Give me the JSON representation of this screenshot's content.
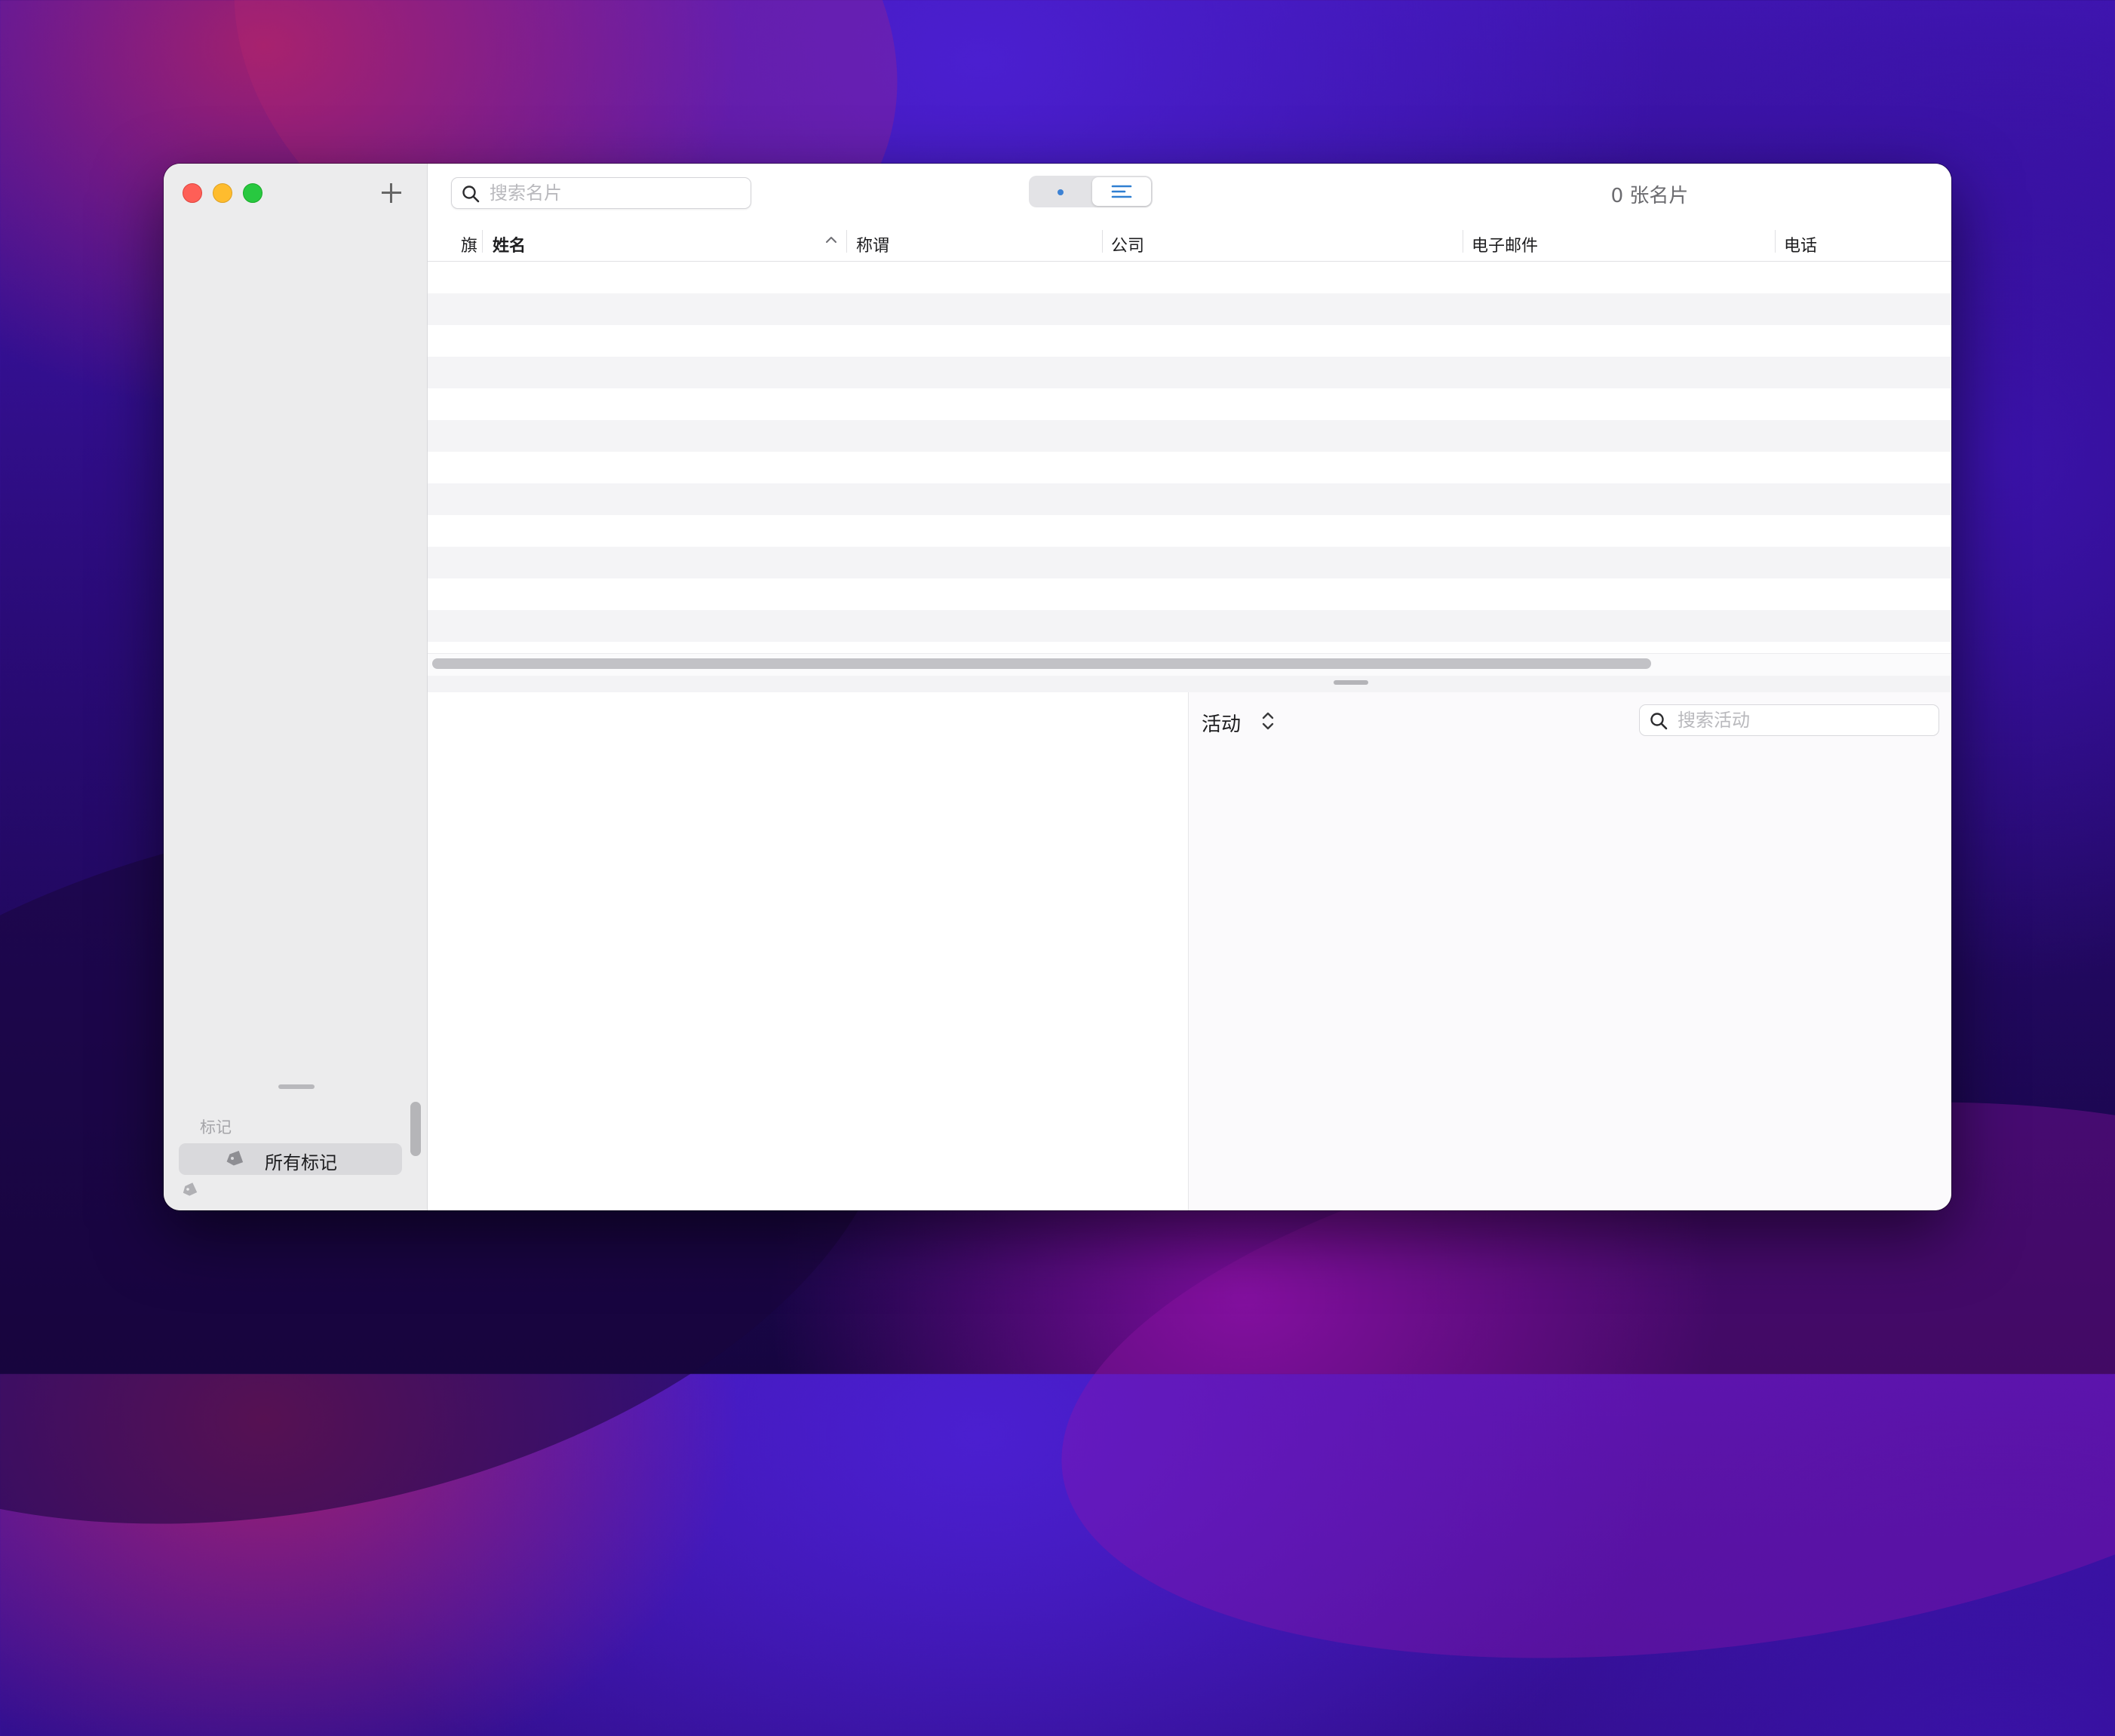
{
  "toolbar": {
    "search_placeholder": "搜索名片",
    "card_count": "0 张名片"
  },
  "table": {
    "columns": {
      "flag": "旗",
      "name": "姓名",
      "title": "称谓",
      "company": "公司",
      "email": "电子邮件",
      "phone": "电话"
    },
    "sort_column": "name",
    "sort_direction": "ascending",
    "rows": []
  },
  "sidebar": {
    "tags_header": "标记",
    "all_tags_label": "所有标记"
  },
  "activity": {
    "title": "活动",
    "search_placeholder": "搜索活动"
  },
  "colors": {
    "close": "#fe5f57",
    "minimize": "#febc2e",
    "zoom": "#28c840",
    "accent": "#3d82d4"
  },
  "icons": {
    "add": "plus-icon",
    "search": "magnifier-icon",
    "card_view": "dot-icon",
    "list_view": "list-lines-icon",
    "sort": "chevron-up-icon",
    "activity_picker": "up-down-chevron-icon",
    "tag": "tag-icon"
  }
}
